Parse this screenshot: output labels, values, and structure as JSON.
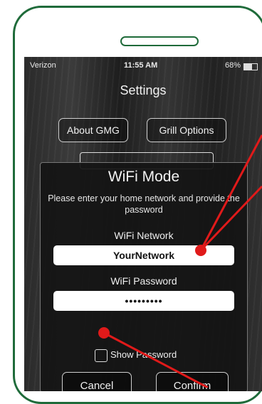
{
  "status_bar": {
    "carrier": "Verizon",
    "time": "11:55 AM",
    "battery": "68%"
  },
  "screen": {
    "title": "Settings"
  },
  "top_buttons": {
    "about": "About GMG",
    "grill_options": "Grill Options"
  },
  "dialog": {
    "title": "WiFi Mode",
    "message": "Please enter your home network and provide the password",
    "network_label": "WiFi Network",
    "network_value": "YourNetwork",
    "password_label": "WiFi Password",
    "password_value": "•••••••••",
    "show_password_label": "Show Password",
    "cancel_label": "Cancel",
    "confirm_label": "Confirm"
  },
  "colors": {
    "phone_outline": "#1f6b3a",
    "annotation": "#e01a1a"
  },
  "icons": [
    "signal-icon",
    "wifi-icon",
    "bluetooth-icon",
    "battery-icon",
    "checkbox-icon"
  ]
}
